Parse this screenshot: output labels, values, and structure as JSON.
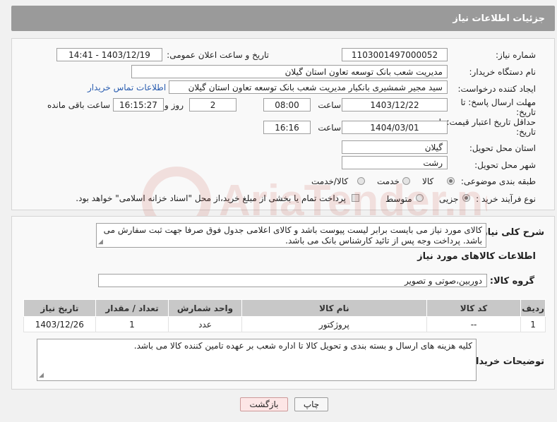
{
  "header": {
    "title": "جزئیات اطلاعات نیاز"
  },
  "form": {
    "need_number_label": "شماره نیاز:",
    "need_number": "1103001497000052",
    "announce_label": "تاریخ و ساعت اعلان عمومی:",
    "announce_value": "1403/12/19 - 14:41",
    "buyer_org_label": "نام دستگاه خریدار:",
    "buyer_org": "مدیریت شعب بانک توسعه تعاون استان گیلان",
    "creator_label": "ایجاد کننده درخواست:",
    "creator": "سید مجیر شمشیری بانکیار مدیریت شعب بانک توسعه تعاون استان گیلان",
    "buyer_contact_link": "اطلاعات تماس خریدار",
    "reply_deadline_label": "مهلت ارسال پاسخ: تا تاریخ:",
    "reply_date": "1403/12/22",
    "time_label": "ساعت",
    "reply_time": "08:00",
    "days_value": "2",
    "days_and_label": "روز و",
    "remaining_time": "16:15:27",
    "remaining_label": "ساعت باقی مانده",
    "price_validity_label": "حداقل تاریخ اعتبار قیمت: تا تاریخ:",
    "validity_date": "1404/03/01",
    "validity_time_label": "ساعت",
    "validity_time": "16:16",
    "province_label": "استان محل تحویل:",
    "province": "گیلان",
    "city_label": "شهر محل تحویل:",
    "city": "رشت",
    "category_label": "طبقه بندی موضوعی:",
    "category_options": [
      "کالا",
      "خدمت",
      "کالا/خدمت"
    ],
    "process_label": "نوع فرآیند خرید :",
    "process_options": [
      "جزیی",
      "متوسط"
    ],
    "payment_note": "پرداخت تمام یا بخشی از مبلغ خرید،از محل \"اسناد خزانه اسلامی\" خواهد بود."
  },
  "details": {
    "description_label": "شرح کلی نیاز:",
    "description": "کالای مورد نیاز می بایست برابر لیست پیوست باشد و کالای اعلامی جدول فوق صرفا جهت ثبت سفارش می باشد. پرداخت وجه پس از تائید کارشناس بانک می باشد.",
    "goods_info_title": "اطلاعات کالاهای مورد نیاز",
    "goods_group_label": "گروه کالا:",
    "goods_group": "دوربین،صوتی و تصویر",
    "table": {
      "headers": [
        "ردیف",
        "کد کالا",
        "نام کالا",
        "واحد شمارش",
        "تعداد / مقدار",
        "تاریخ نیاز"
      ],
      "rows": [
        [
          "1",
          "--",
          "پروژکتور",
          "عدد",
          "1",
          "1403/12/26"
        ]
      ]
    },
    "buyer_notes_label": "توضیحات خریدار:",
    "buyer_notes": "کلیه هزینه های ارسال و بسته بندی و تحویل کالا تا اداره شعب بر عهده تامین کننده کالا می باشد."
  },
  "buttons": {
    "print": "چاپ",
    "back": "بازگشت"
  },
  "watermark": {
    "text": "AriaTender.net"
  }
}
